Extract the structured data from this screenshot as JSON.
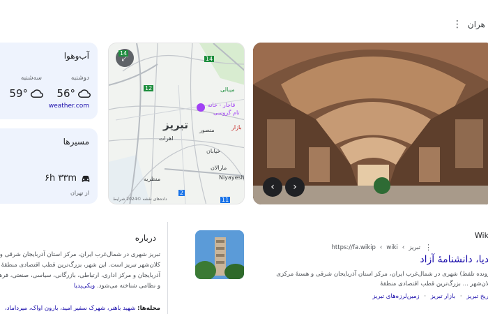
{
  "top": {
    "label": "هران"
  },
  "weather": {
    "title": "آب‌وهوا",
    "days": [
      {
        "day": "دوشنبه",
        "temp": "56°",
        "icon": "cloud-icon"
      },
      {
        "day": "سه‌شنبه",
        "temp": "59°",
        "icon": "cloud-icon"
      }
    ],
    "source": "weather.com"
  },
  "routes": {
    "title": "مسیرها",
    "time": "۶h ۳۳m",
    "icon": "car-icon",
    "from": "از تهران"
  },
  "map": {
    "city": "تبریز",
    "labels": {
      "khane": "قاجار - خانه",
      "museum": "تام گروسی",
      "emami": "میبالی",
      "bazar": "بازار",
      "mansour": "منصور",
      "khayaban": "خیابان",
      "maralan": "مارالان",
      "niyayesh": "Niyayesh B",
      "eram": "اهرات",
      "manzarie": "منظریه",
      "road14a": "14",
      "road14b": "14",
      "road12": "12",
      "road2": "2",
      "road10": "11"
    },
    "attribution": "داده‌های نقشه ©2024   شرایط"
  },
  "photo": {
    "prev": "‹",
    "next": "›"
  },
  "about": {
    "title": "درباره",
    "body": "تبریز شهری در شمال‌غرب ایران، مرکز استان آذربایجان شرقی و کلان‌شهر تبریز است. این شهر، بزرگ‌ترین قطب اقتصادی منطقهٔ آذربایجان و مرکز اداری، ارتباطی، بازرگانی، سیاسی، صنعتی، فرهنگی و نظامی شناخته می‌شود.",
    "wiki_link": "ویکی‌پدیا",
    "neigh_label": "محله‌ها:",
    "neighborhoods": "شهید باهنر، شهرک سفیر امید، بارون آواک، میرداماد،"
  },
  "result": {
    "site": "Wiki",
    "url": "https://fa.wikip",
    "crumbs": [
      "wiki",
      "تبریز"
    ],
    "title": "پدیا، دانشنامهٔ آزاد",
    "snippet": "پرونده تلفظ) شهری در شمال‌غرب ایران، مرکز استان آذربایجان شرقی و هستهٔ مرکزی کلان‌شهر ... بزرگ‌ترین قطب اقتصادی منطقهٔ",
    "links": [
      "تاریخ تبریز",
      "بازار تبریز",
      "زمین‌لرزه‌های تبریز"
    ]
  }
}
